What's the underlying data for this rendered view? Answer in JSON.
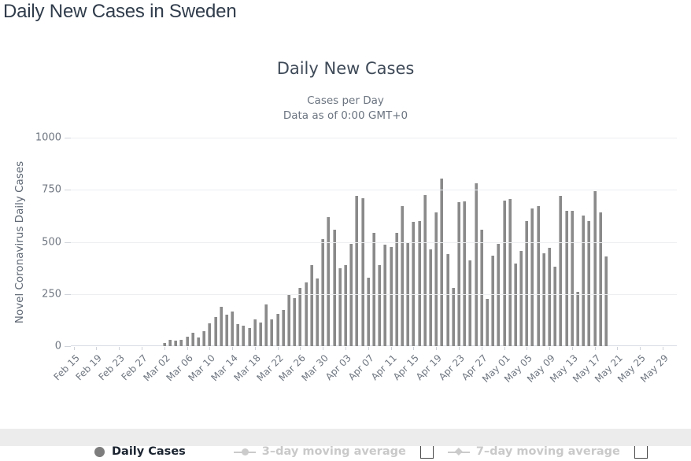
{
  "page": {
    "title": "Daily New Cases in Sweden"
  },
  "chart_data": {
    "type": "bar",
    "title": "Daily New Cases",
    "subtitle_lines": [
      "Cases per Day",
      "Data as of 0:00 GMT+0"
    ],
    "xlabel": "",
    "ylabel": "Novel Coronavirus Daily Cases",
    "ylim": [
      0,
      1000
    ],
    "yticks": [
      0,
      250,
      500,
      750,
      1000
    ],
    "ytick_labels": [
      "0",
      "250",
      "500",
      "750",
      "1000"
    ],
    "grid": true,
    "bar_color": "#8a8a8a",
    "x_tick_step": 4,
    "x_tick_labels": [
      "Feb 15",
      "Feb 19",
      "Feb 23",
      "Feb 27",
      "Mar 02",
      "Mar 06",
      "Mar 10",
      "Mar 14",
      "Mar 18",
      "Mar 22",
      "Mar 26",
      "Mar 30",
      "Apr 03",
      "Apr 07",
      "Apr 11",
      "Apr 15",
      "Apr 19",
      "Apr 23",
      "Apr 27",
      "May 01",
      "May 05",
      "May 09",
      "May 13",
      "May 17",
      "May 21",
      "May 25",
      "May 29"
    ],
    "categories": [
      "Feb 15",
      "Feb 16",
      "Feb 17",
      "Feb 18",
      "Feb 19",
      "Feb 20",
      "Feb 21",
      "Feb 22",
      "Feb 23",
      "Feb 24",
      "Feb 25",
      "Feb 26",
      "Feb 27",
      "Feb 28",
      "Feb 29",
      "Mar 01",
      "Mar 02",
      "Mar 03",
      "Mar 04",
      "Mar 05",
      "Mar 06",
      "Mar 07",
      "Mar 08",
      "Mar 09",
      "Mar 10",
      "Mar 11",
      "Mar 12",
      "Mar 13",
      "Mar 14",
      "Mar 15",
      "Mar 16",
      "Mar 17",
      "Mar 18",
      "Mar 19",
      "Mar 20",
      "Mar 21",
      "Mar 22",
      "Mar 23",
      "Mar 24",
      "Mar 25",
      "Mar 26",
      "Mar 27",
      "Mar 28",
      "Mar 29",
      "Mar 30",
      "Mar 31",
      "Apr 01",
      "Apr 02",
      "Apr 03",
      "Apr 04",
      "Apr 05",
      "Apr 06",
      "Apr 07",
      "Apr 08",
      "Apr 09",
      "Apr 10",
      "Apr 11",
      "Apr 12",
      "Apr 13",
      "Apr 14",
      "Apr 15",
      "Apr 16",
      "Apr 17",
      "Apr 18",
      "Apr 19",
      "Apr 20",
      "Apr 21",
      "Apr 22",
      "Apr 23",
      "Apr 24",
      "Apr 25",
      "Apr 26",
      "Apr 27",
      "Apr 28",
      "Apr 29",
      "Apr 30",
      "May 01",
      "May 02",
      "May 03",
      "May 04",
      "May 05",
      "May 06",
      "May 07",
      "May 08",
      "May 09",
      "May 10",
      "May 11",
      "May 12",
      "May 13",
      "May 14",
      "May 15",
      "May 16",
      "May 17",
      "May 18",
      "May 19",
      "May 20",
      "May 21",
      "May 22",
      "May 23",
      "May 24",
      "May 25",
      "May 26",
      "May 27",
      "May 28",
      "May 29",
      "May 30",
      "May 31"
    ],
    "series": [
      {
        "name": "Daily Cases",
        "values": [
          0,
          0,
          0,
          0,
          0,
          0,
          0,
          0,
          0,
          0,
          0,
          0,
          0,
          0,
          0,
          0,
          15,
          30,
          25,
          30,
          45,
          65,
          40,
          70,
          110,
          140,
          190,
          150,
          165,
          105,
          100,
          85,
          130,
          115,
          200,
          130,
          155,
          175,
          250,
          230,
          280,
          305,
          390,
          325,
          515,
          620,
          560,
          375,
          390,
          490,
          720,
          710,
          330,
          545,
          390,
          485,
          475,
          545,
          670,
          495,
          595,
          600,
          725,
          465,
          640,
          805,
          440,
          280,
          690,
          695,
          410,
          780,
          560,
          225,
          435,
          490,
          700,
          705,
          395,
          455,
          600,
          660,
          670,
          445,
          470,
          380,
          720,
          650,
          650,
          260,
          625,
          600,
          745,
          640,
          430,
          0,
          0,
          0,
          0,
          0,
          0,
          0,
          0,
          0,
          0,
          0,
          0
        ]
      }
    ],
    "legend": {
      "position": "bottom",
      "items": [
        {
          "label": "Daily Cases",
          "active": true,
          "marker": "dot",
          "has_checkbox": false
        },
        {
          "label": "3–day moving average",
          "active": false,
          "marker": "line-diamond",
          "has_checkbox": true
        },
        {
          "label": "7–day moving average",
          "active": false,
          "marker": "line-arrow",
          "has_checkbox": true
        }
      ]
    }
  }
}
